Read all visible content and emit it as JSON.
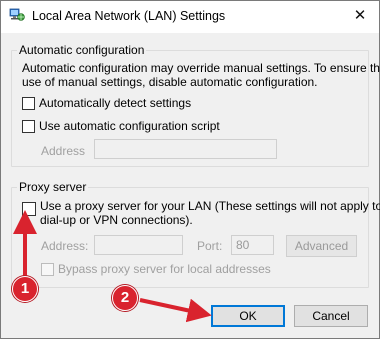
{
  "window": {
    "title": "Local Area Network (LAN) Settings",
    "close_glyph": "✕"
  },
  "auto_config": {
    "legend": "Automatic configuration",
    "description_line1": "Automatic configuration may override manual settings.  To ensure the",
    "description_line2": "use of manual settings, disable automatic configuration.",
    "detect_label": "Automatically detect settings",
    "detect_checked": false,
    "script_label": "Use automatic configuration script",
    "script_checked": false,
    "address_label": "Address",
    "address_value": ""
  },
  "proxy": {
    "legend": "Proxy server",
    "use_proxy_line1": "Use a proxy server for your LAN (These settings will not apply to",
    "use_proxy_line2": "dial-up or VPN connections).",
    "use_proxy_checked": false,
    "address_label": "Address:",
    "address_value": "",
    "port_label": "Port:",
    "port_value": "80",
    "advanced_label": "Advanced",
    "bypass_label": "Bypass proxy server for local addresses",
    "bypass_checked": false
  },
  "buttons": {
    "ok_label": "OK",
    "cancel_label": "Cancel"
  },
  "annotations": {
    "step1": "1",
    "step2": "2",
    "color": "#d9232e"
  }
}
